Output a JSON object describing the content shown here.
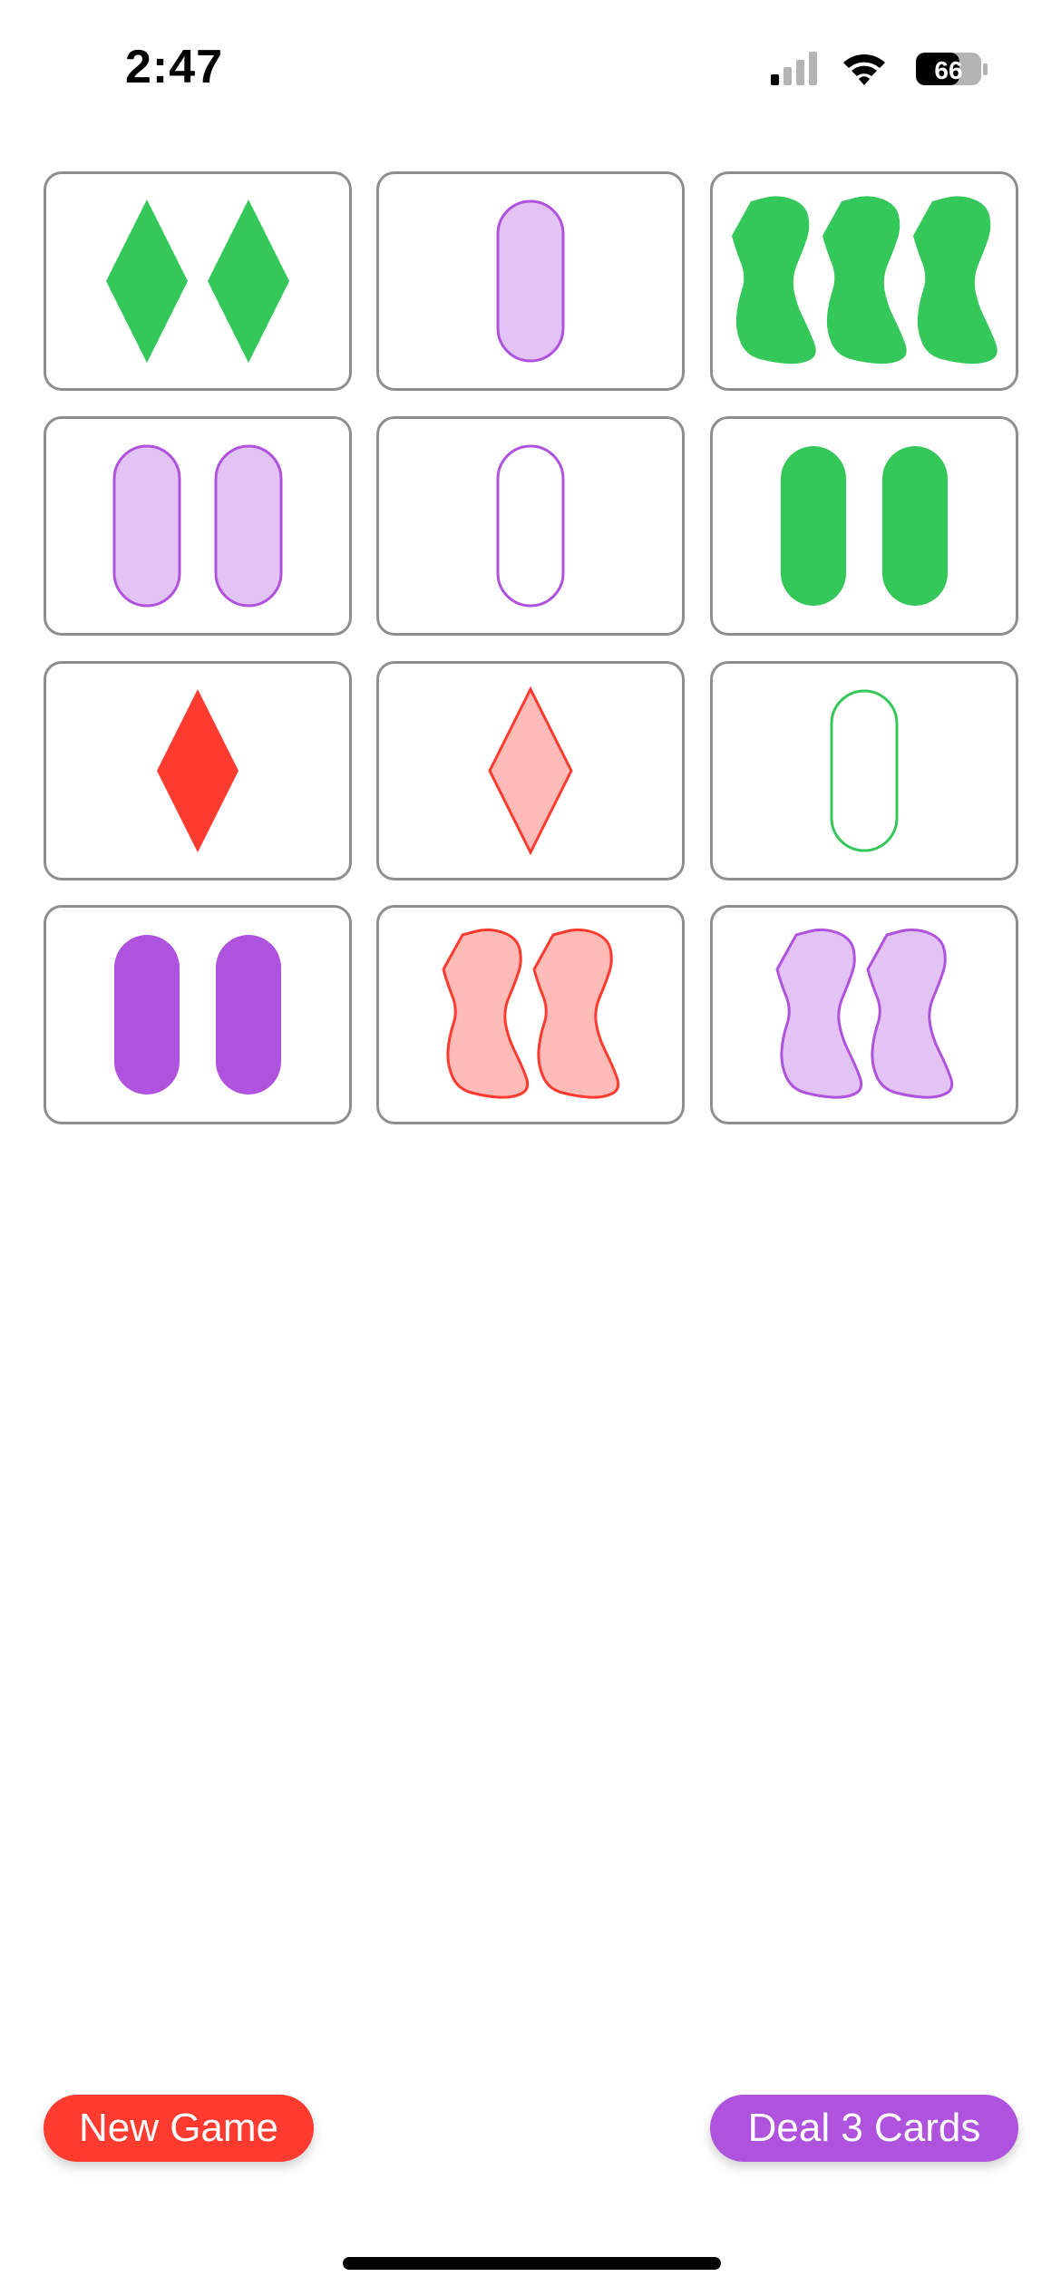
{
  "status_bar": {
    "time": "2:47",
    "battery": "66",
    "icons": [
      "cellular-signal-icon",
      "wifi-icon",
      "battery-icon"
    ]
  },
  "colors": {
    "red": "#FF3B30",
    "green": "#34C759",
    "purple": "#AF52DE"
  },
  "cards": [
    {
      "count": 2,
      "shape": "diamond",
      "color": "green",
      "shading": "solid"
    },
    {
      "count": 1,
      "shape": "oval",
      "color": "purple",
      "shading": "striped"
    },
    {
      "count": 3,
      "shape": "squiggle",
      "color": "green",
      "shading": "solid"
    },
    {
      "count": 2,
      "shape": "oval",
      "color": "purple",
      "shading": "striped"
    },
    {
      "count": 1,
      "shape": "oval",
      "color": "purple",
      "shading": "open"
    },
    {
      "count": 2,
      "shape": "oval",
      "color": "green",
      "shading": "solid"
    },
    {
      "count": 1,
      "shape": "diamond",
      "color": "red",
      "shading": "solid"
    },
    {
      "count": 1,
      "shape": "diamond",
      "color": "red",
      "shading": "striped"
    },
    {
      "count": 1,
      "shape": "oval",
      "color": "green",
      "shading": "open"
    },
    {
      "count": 2,
      "shape": "oval",
      "color": "purple",
      "shading": "solid"
    },
    {
      "count": 2,
      "shape": "squiggle",
      "color": "red",
      "shading": "striped"
    },
    {
      "count": 2,
      "shape": "squiggle",
      "color": "purple",
      "shading": "striped"
    }
  ],
  "buttons": {
    "new_game": "New Game",
    "deal": "Deal 3 Cards",
    "new_game_color": "#FF3B30",
    "deal_color": "#AF52DE"
  }
}
